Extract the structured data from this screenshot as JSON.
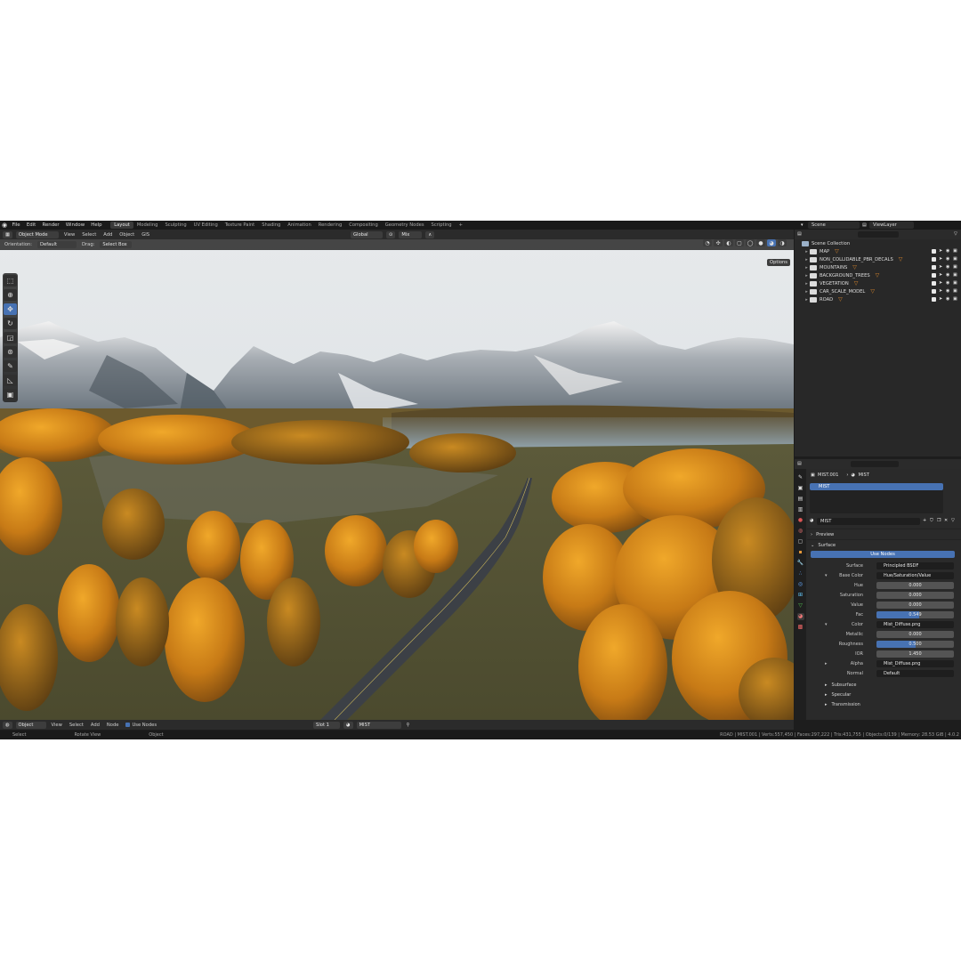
{
  "app_menu": {
    "items": [
      "File",
      "Edit",
      "Render",
      "Window",
      "Help"
    ],
    "workspaces": [
      "Layout",
      "Modeling",
      "Sculpting",
      "UV Editing",
      "Texture Paint",
      "Shading",
      "Animation",
      "Rendering",
      "Compositing",
      "Geometry Nodes",
      "Scripting"
    ],
    "active_workspace": "Layout",
    "add_tab": "+",
    "scene": "Scene",
    "view_layer": "ViewLayer"
  },
  "viewport_header": {
    "mode": "Object Mode",
    "menus": [
      "View",
      "Select",
      "Add",
      "Object",
      "GIS"
    ],
    "transform_orientation": "Global",
    "pivot": "Mix",
    "orientation_label": "Orientation:",
    "orientation_value": "Default",
    "drag_label": "Drag:",
    "drag_value": "Select Box",
    "options": "Options"
  },
  "outliner": {
    "root": "Scene Collection",
    "collections": [
      {
        "name": "MAP"
      },
      {
        "name": "NON_COLLIDABLE_PBR_DECALS"
      },
      {
        "name": "MOUNTAINS"
      },
      {
        "name": "BACKGROUND_TREES"
      },
      {
        "name": "VEGETATION"
      },
      {
        "name": "CAR_SCALE_MODEL"
      },
      {
        "name": "ROAD"
      }
    ]
  },
  "properties": {
    "breadcrumb_object": "MIST.001",
    "breadcrumb_material": "MIST",
    "slot_name": "MIST",
    "material_name": "MIST",
    "panel_preview": "Preview",
    "panel_surface": "Surface",
    "use_nodes": "Use Nodes",
    "rows": {
      "surface": {
        "label": "Surface",
        "value": "Principled BSDF"
      },
      "base_color": {
        "label": "Base Color",
        "value": "Hue/Saturation/Value"
      },
      "hue": {
        "label": "Hue",
        "value": "0.000"
      },
      "saturation": {
        "label": "Saturation",
        "value": "0.000"
      },
      "value": {
        "label": "Value",
        "value": "0.000"
      },
      "fac": {
        "label": "Fac",
        "value": "0.549"
      },
      "color": {
        "label": "Color",
        "value": "Mist_Diffuse.png"
      },
      "metallic": {
        "label": "Metallic",
        "value": "0.000"
      },
      "roughness": {
        "label": "Roughness",
        "value": "0.500"
      },
      "ior": {
        "label": "IOR",
        "value": "1.450"
      },
      "alpha": {
        "label": "Alpha",
        "value": "Mist_Diffuse.png"
      },
      "normal": {
        "label": "Normal",
        "value": "Default"
      }
    },
    "sub_panels": [
      "Subsurface",
      "Specular",
      "Transmission"
    ]
  },
  "node_header": {
    "editor": "Object",
    "menus": [
      "View",
      "Select",
      "Add",
      "Node"
    ],
    "use_nodes": "Use Nodes",
    "slot": "Slot 1",
    "material": "MIST"
  },
  "statusbar": {
    "select": "Select",
    "rotate": "Rotate View",
    "object": "Object",
    "stats": "ROAD | MIST.001 | Verts:557,450 | Faces:297,222 | Tris:431,755 | Objects:0/139 | Memory: 28.53 GiB | 4.0.2"
  },
  "colors": {
    "accent": "#4772b3",
    "collection_icon": "#e08a2c",
    "sky": "#dfe3e6",
    "foliage": "#c9801e"
  }
}
